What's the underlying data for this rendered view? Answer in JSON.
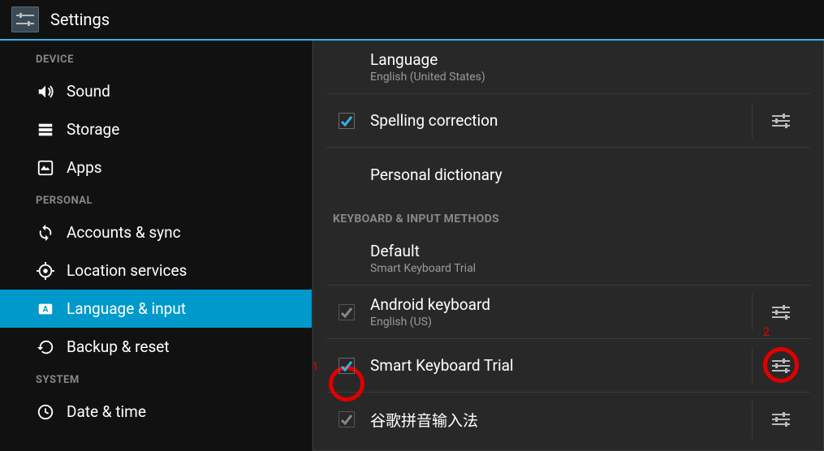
{
  "header": {
    "title": "Settings"
  },
  "sidebar": {
    "sections": [
      {
        "label": "DEVICE",
        "items": [
          {
            "id": "sound",
            "label": "Sound"
          },
          {
            "id": "storage",
            "label": "Storage"
          },
          {
            "id": "apps",
            "label": "Apps"
          }
        ]
      },
      {
        "label": "PERSONAL",
        "items": [
          {
            "id": "accounts",
            "label": "Accounts & sync"
          },
          {
            "id": "location",
            "label": "Location services"
          },
          {
            "id": "language",
            "label": "Language & input",
            "selected": true
          },
          {
            "id": "backup",
            "label": "Backup & reset"
          }
        ]
      },
      {
        "label": "SYSTEM",
        "items": [
          {
            "id": "datetime",
            "label": "Date & time"
          }
        ]
      }
    ]
  },
  "content": {
    "top": [
      {
        "id": "language",
        "title": "Language",
        "sub": "English (United States)"
      },
      {
        "id": "spelling",
        "title": "Spelling correction",
        "checked": true,
        "gear": true
      },
      {
        "id": "dictionary",
        "title": "Personal dictionary"
      }
    ],
    "kbSectionLabel": "KEYBOARD & INPUT METHODS",
    "kb": [
      {
        "id": "default",
        "title": "Default",
        "sub": "Smart Keyboard Trial"
      },
      {
        "id": "android-kbd",
        "title": "Android keyboard",
        "sub": "English (US)",
        "checked": true,
        "locked": true,
        "gear": true
      },
      {
        "id": "smart-kbd",
        "title": "Smart Keyboard Trial",
        "checked": true,
        "gear": true,
        "annotLeft": "1",
        "annotRight": "2"
      },
      {
        "id": "google-pinyin",
        "title": "谷歌拼音输入法",
        "checked": true,
        "locked": true,
        "gear": true
      }
    ]
  }
}
